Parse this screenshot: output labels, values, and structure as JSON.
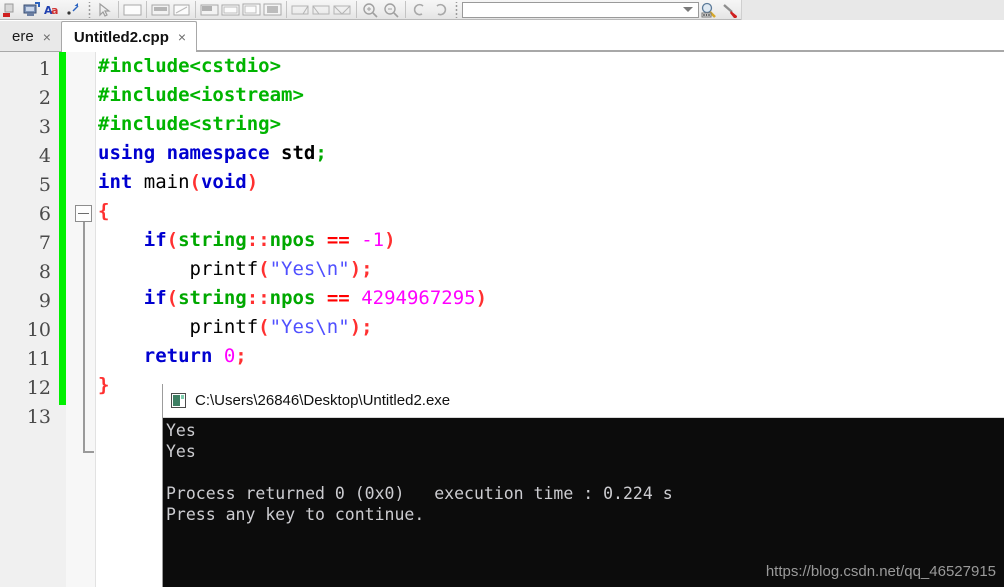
{
  "toolbar": {
    "left_icons": [
      {
        "name": "stop-icon",
        "label": "Stop"
      },
      {
        "name": "rebuild-run-icon",
        "label": "Rebuild and run"
      },
      {
        "name": "abort-icon",
        "label": "Abort"
      },
      {
        "name": "next-error-icon",
        "label": "Next error"
      }
    ],
    "debug_icons": [
      {
        "name": "debug-pointer-icon",
        "label": "Debug"
      },
      {
        "name": "debug-window-icon",
        "label": "Debugging windows"
      },
      {
        "name": "step-into-icon",
        "label": "Step into"
      },
      {
        "name": "step-out-icon",
        "label": "Step out"
      },
      {
        "name": "run-to-cursor-icon",
        "label": "Run to cursor"
      },
      {
        "name": "next-line-icon",
        "label": "Next line"
      },
      {
        "name": "next-instruction-icon",
        "label": "Next instruction"
      },
      {
        "name": "step-over-icon",
        "label": "Step over"
      },
      {
        "name": "break-icon",
        "label": "Break"
      },
      {
        "name": "watch-icon",
        "label": "Watches"
      },
      {
        "name": "breakpoint-icon",
        "label": "Toggle breakpoint"
      },
      {
        "name": "various-icon",
        "label": "Various"
      },
      {
        "name": "zoom-in-icon",
        "label": "Zoom in"
      },
      {
        "name": "zoom-out-icon",
        "label": "Zoom out"
      },
      {
        "name": "undo-icon",
        "label": "Undo"
      },
      {
        "name": "redo-icon",
        "label": "Redo"
      }
    ],
    "search_combo": {
      "name": "search-combo",
      "value": "",
      "placeholder": ""
    },
    "right_icons": [
      {
        "name": "find-icon",
        "label": "Find"
      },
      {
        "name": "replace-icon",
        "label": "Replace"
      }
    ]
  },
  "tabs": [
    {
      "label": "ere",
      "close": "×",
      "active": false
    },
    {
      "label": "Untitled2.cpp",
      "close": "×",
      "active": true
    }
  ],
  "editor": {
    "line_numbers": [
      "1",
      "2",
      "3",
      "4",
      "5",
      "6",
      "7",
      "8",
      "9",
      "10",
      "11",
      "12",
      "13"
    ],
    "lines": [
      {
        "n": "1",
        "text": "#include<cstdio>"
      },
      {
        "n": "2",
        "text": "#include<iostream>"
      },
      {
        "n": "3",
        "text": "#include<string>"
      },
      {
        "n": "4",
        "text": "using namespace std;"
      },
      {
        "n": "5",
        "text": "int main(void)"
      },
      {
        "n": "6",
        "text": "{"
      },
      {
        "n": "7",
        "text": "    if(string::npos == -1)"
      },
      {
        "n": "8",
        "text": "        printf(\"Yes\\n\");"
      },
      {
        "n": "9",
        "text": "    if(string::npos == 4294967295)"
      },
      {
        "n": "10",
        "text": "        printf(\"Yes\\n\");"
      },
      {
        "n": "11",
        "text": "    return 0;"
      },
      {
        "n": "12",
        "text": "}"
      },
      {
        "n": "13",
        "text": ""
      }
    ],
    "colors": {
      "preprocessor": "#00b400",
      "keyword": "#0000d0",
      "string": "#5050ff",
      "number": "#ff00ff",
      "operator": "#ff0000",
      "changebar": "#00f000",
      "background": "#ffffff",
      "gutter": "#f0f0f0"
    }
  },
  "console": {
    "title": "C:\\Users\\26846\\Desktop\\Untitled2.exe",
    "icon": "console-app-icon",
    "output_lines": [
      "Yes",
      "Yes",
      "",
      "Process returned 0 (0x0)   execution time : 0.224 s",
      "Press any key to continue."
    ],
    "output_text": "Yes\nYes\n\nProcess returned 0 (0x0)   execution time : 0.224 s\nPress any key to continue.",
    "return_code": "0",
    "return_code_hex": "0x0",
    "execution_time": "0.224 s",
    "background": "#0c0c0c",
    "foreground": "#ccccd0"
  },
  "watermark": {
    "text": "https://blog.csdn.net/qq_46527915"
  }
}
